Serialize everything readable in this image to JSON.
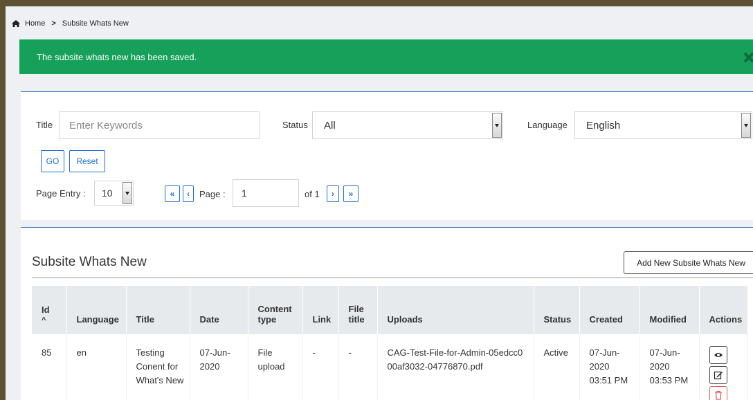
{
  "breadcrumb": {
    "home": "Home",
    "current": "Subsite Whats New"
  },
  "alert": {
    "message": "The subsite whats new has been saved."
  },
  "filter": {
    "title_label": "Title",
    "title_placeholder": "Enter Keywords",
    "status_label": "Status",
    "status_value": "All",
    "language_label": "Language",
    "language_value": "English",
    "go_label": "GO",
    "reset_label": "Reset",
    "page_entry_label": "Page Entry :",
    "page_entry_value": "10",
    "page_label": "Page :",
    "page_value": "1",
    "of_label": "of 1"
  },
  "list": {
    "title": "Subsite Whats New",
    "add_label": "Add New Subsite Whats New",
    "headers": {
      "id": "Id",
      "sort": "^",
      "language": "Language",
      "title": "Title",
      "date": "Date",
      "content_type": "Content type",
      "link": "Link",
      "file_title": "File title",
      "uploads": "Uploads",
      "status": "Status",
      "created": "Created",
      "modified": "Modified",
      "actions": "Actions"
    },
    "rows": [
      {
        "id": "85",
        "language": "en",
        "title": "Testing Conent for What's New",
        "date": "07-Jun-2020",
        "content_type": "File upload",
        "link": "-",
        "file_title": "-",
        "uploads": "CAG-Test-File-for-Admin-05edcc000af3032-04776870.pdf",
        "status": "Active",
        "created": "07-Jun-2020 03:51 PM",
        "modified": "07-Jun-2020 03:53 PM"
      }
    ]
  },
  "colors": {
    "success": "#16a05a",
    "primary": "#1f6fd1",
    "danger": "#e25b5b"
  }
}
